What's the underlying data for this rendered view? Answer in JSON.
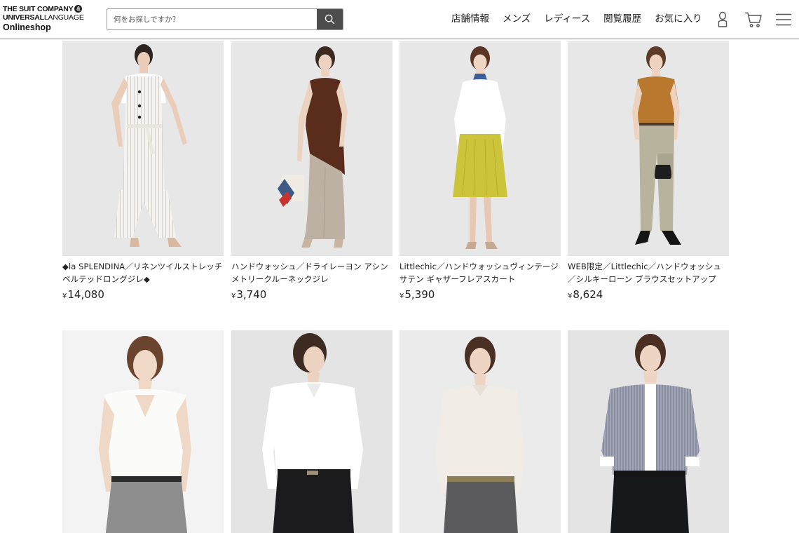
{
  "header": {
    "logo": {
      "line1": "THE SUIT COMPANY",
      "amp": "&",
      "line2_bold": "UNIVERSAL",
      "line2_light": "LANGUAGE",
      "line3": "Onlineshop"
    },
    "search": {
      "placeholder": "何をお探しですか？"
    },
    "nav": [
      "店舗情報",
      "メンズ",
      "レディース",
      "閲覧履歴",
      "お気に入り"
    ],
    "icons": [
      "user-icon",
      "cart-icon",
      "menu-icon"
    ]
  },
  "products": [
    {
      "name": "◆la SPLENDINA／リネンツイルストレッチベルテッドロングジレ◆",
      "price_symbol": "¥",
      "price": "14,080"
    },
    {
      "name": "ハンドウォッシュ／ドライレーヨン アシンメトリークルーネックジレ",
      "price_symbol": "¥",
      "price": "3,740"
    },
    {
      "name": "Littlechic／ハンドウォッシュヴィンテージサテン ギャザーフレアスカート",
      "price_symbol": "¥",
      "price": "5,390"
    },
    {
      "name": "WEB限定／Littlechic／ハンドウォッシュ／シルキーローン ブラウスセットアップ",
      "price_symbol": "¥",
      "price": "8,624"
    },
    {
      "name": "",
      "price_symbol": "",
      "price": ""
    },
    {
      "name": "",
      "price_symbol": "",
      "price": ""
    },
    {
      "name": "",
      "price_symbol": "",
      "price": ""
    },
    {
      "name": "",
      "price_symbol": "",
      "price": ""
    }
  ],
  "colors": {
    "search_button": "#4d4d4d",
    "header_border": "#8a8a8a",
    "text": "#222222"
  }
}
